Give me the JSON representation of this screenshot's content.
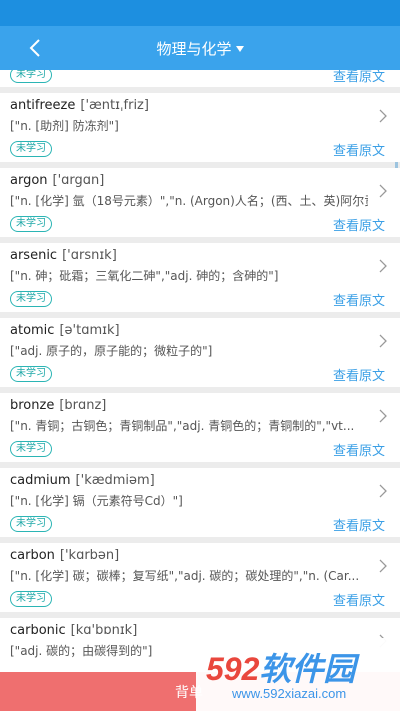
{
  "nav": {
    "title": "物理与化学"
  },
  "entries": [
    {
      "status": "未学习",
      "link": "查看原文"
    },
    {
      "word": "antifreeze",
      "phonetic": "['æntɪˌfriz]",
      "meaning": "[\"n. [助剂] 防冻剂\"]",
      "status": "未学习",
      "link": "查看原文"
    },
    {
      "word": "argon",
      "phonetic": "['ɑrgɑn]",
      "meaning": "[\"n. [化学] 氩（18号元素）\",\"n. (Argon)人名；(西、土、英)阿尔贡\"]",
      "status": "未学习",
      "link": "查看原文"
    },
    {
      "word": "arsenic",
      "phonetic": "['ɑrsnɪk]",
      "meaning": "[\"n. 砷；砒霜；三氧化二砷\",\"adj. 砷的；含砷的\"]",
      "status": "未学习",
      "link": "查看原文"
    },
    {
      "word": "atomic",
      "phonetic": "[ə'tɑmɪk]",
      "meaning": "[\"adj. 原子的，原子能的；微粒子的\"]",
      "status": "未学习",
      "link": "查看原文"
    },
    {
      "word": "bronze",
      "phonetic": "[brɑnz]",
      "meaning": "[\"n. 青铜；古铜色；青铜制品\",\"adj. 青铜色的；青铜制的\",\"vt...",
      "status": "未学习",
      "link": "查看原文"
    },
    {
      "word": "cadmium",
      "phonetic": "['kædmiəm]",
      "meaning": "[\"n. [化学] 镉（元素符号Cd）\"]",
      "status": "未学习",
      "link": "查看原文"
    },
    {
      "word": "carbon",
      "phonetic": "['kɑrbən]",
      "meaning": "[\"n. [化学] 碳；碳棒；复写纸\",\"adj. 碳的；碳处理的\",\"n. (Car...",
      "status": "未学习",
      "link": "查看原文"
    },
    {
      "word": "carbonic",
      "phonetic": "[kɑ'bɒnɪk]",
      "meaning": "[\"adj. 碳的；由碳得到的\"]"
    }
  ],
  "bottom": {
    "label": "背单"
  },
  "watermark": {
    "logo_num": "592",
    "logo_text": "软件园",
    "url": "www.592xiazai.com"
  }
}
